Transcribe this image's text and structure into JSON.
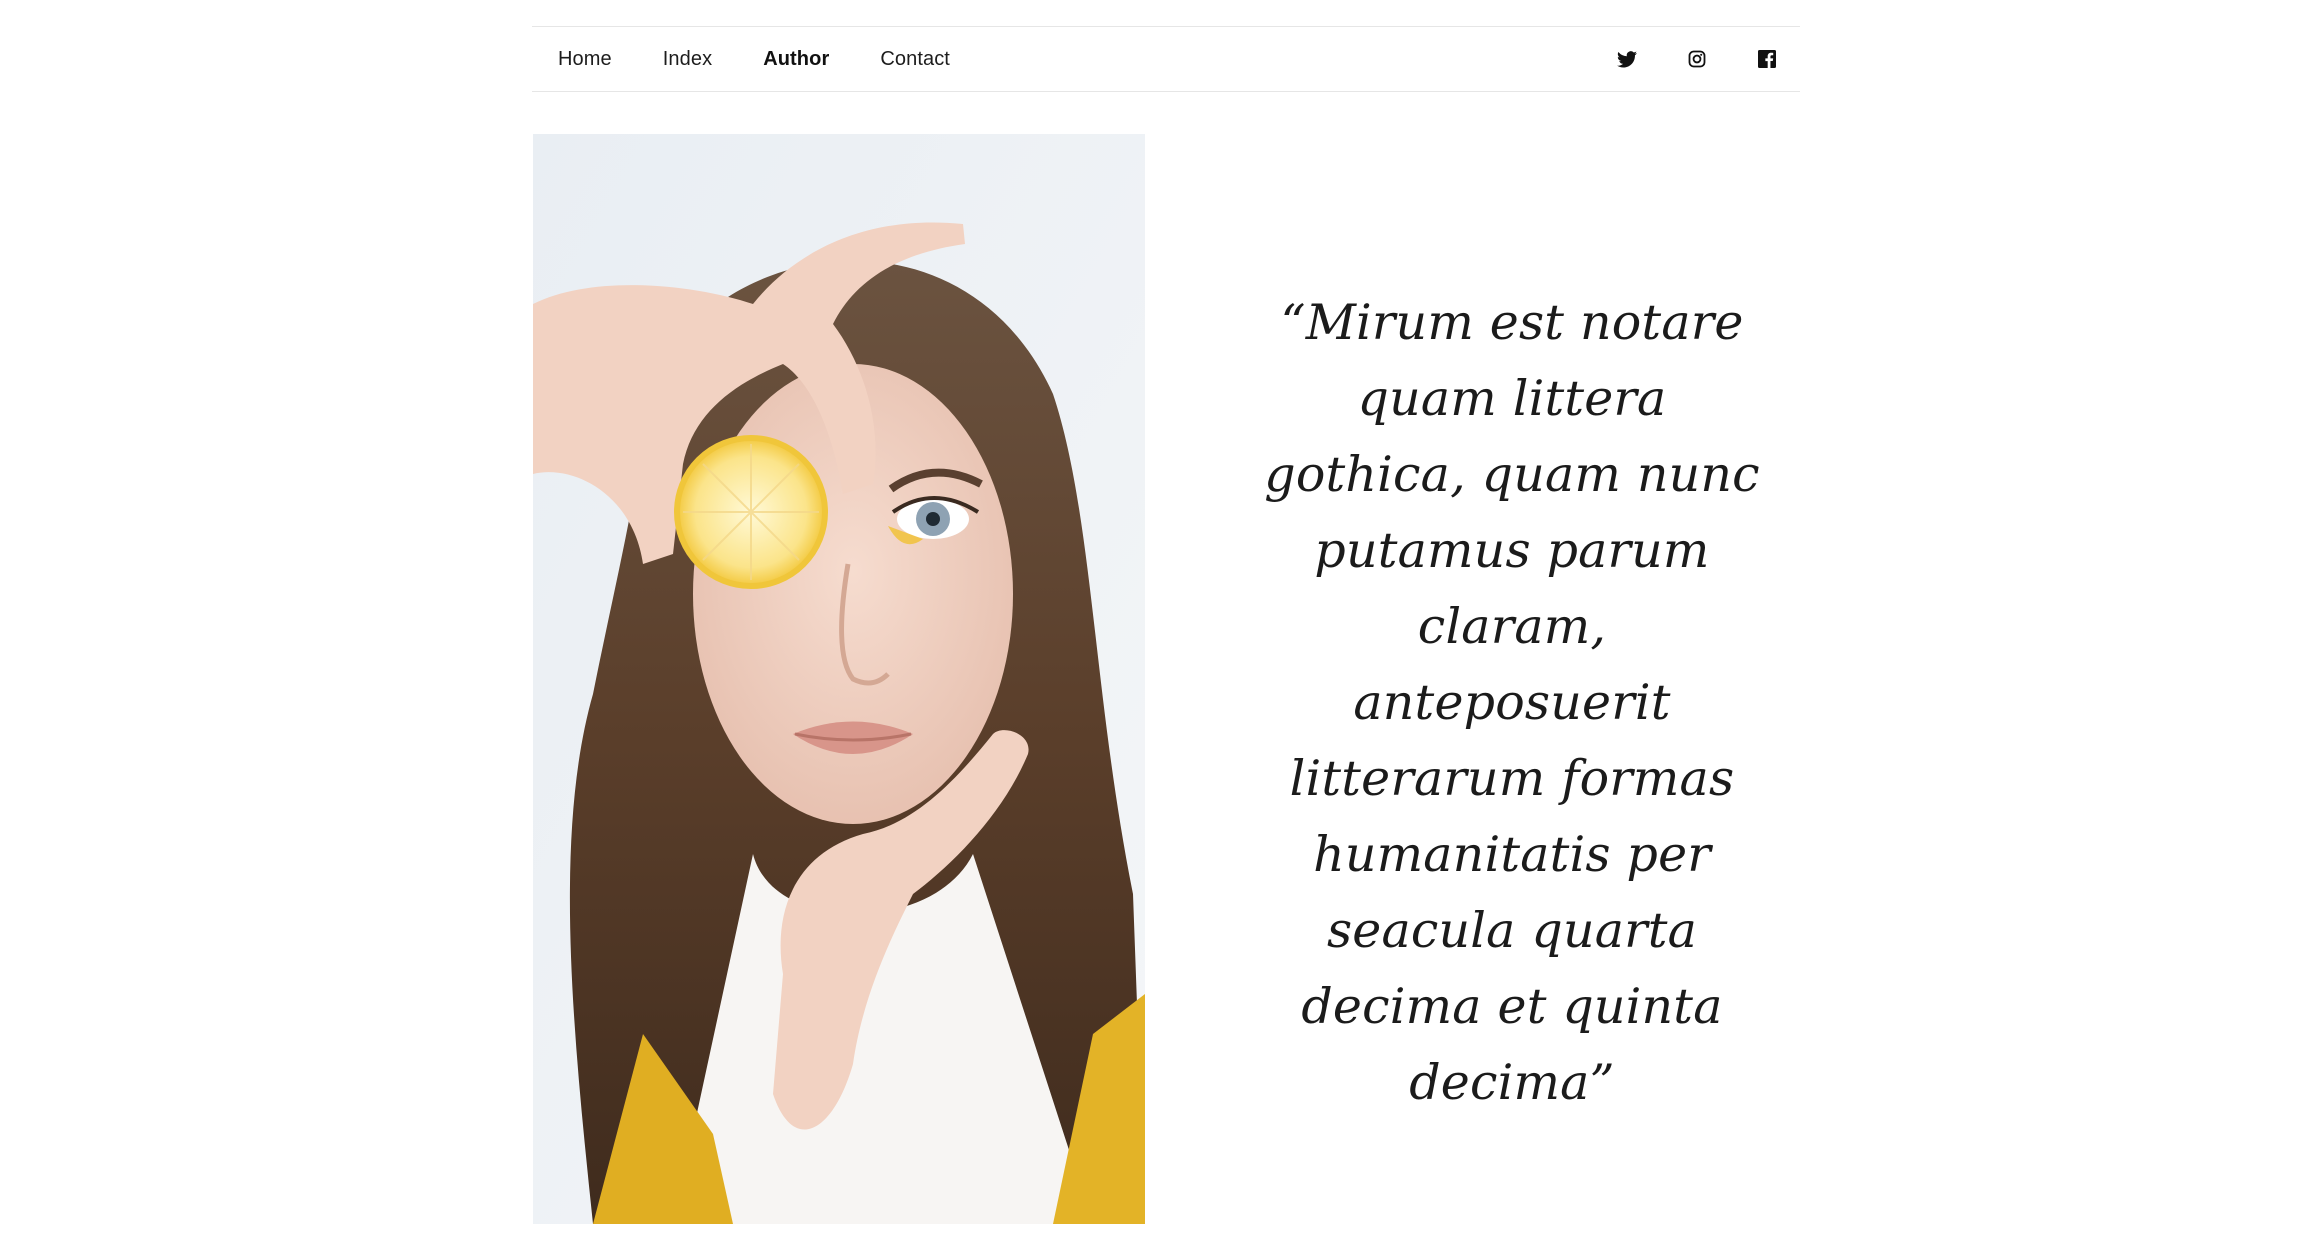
{
  "nav": {
    "links": [
      {
        "label": "Home",
        "active": false
      },
      {
        "label": "Index",
        "active": false
      },
      {
        "label": "Author",
        "active": true
      },
      {
        "label": "Contact",
        "active": false
      }
    ],
    "social": [
      {
        "icon": "twitter-icon"
      },
      {
        "icon": "instagram-icon"
      },
      {
        "icon": "facebook-icon"
      }
    ]
  },
  "hero": {
    "photo_subject": "woman-holding-lemon-slice-over-eye"
  },
  "quote": {
    "text": "“Mirum est notare quam littera gothica, quam nunc putamus parum claram, anteposuerit litterarum formas humanitatis per seacula quarta decima et quinta decima”"
  },
  "colors": {
    "text": "#1b1b1b",
    "border": "#e6e6e6",
    "accent_yellow": "#e3b327",
    "background": "#ffffff"
  }
}
